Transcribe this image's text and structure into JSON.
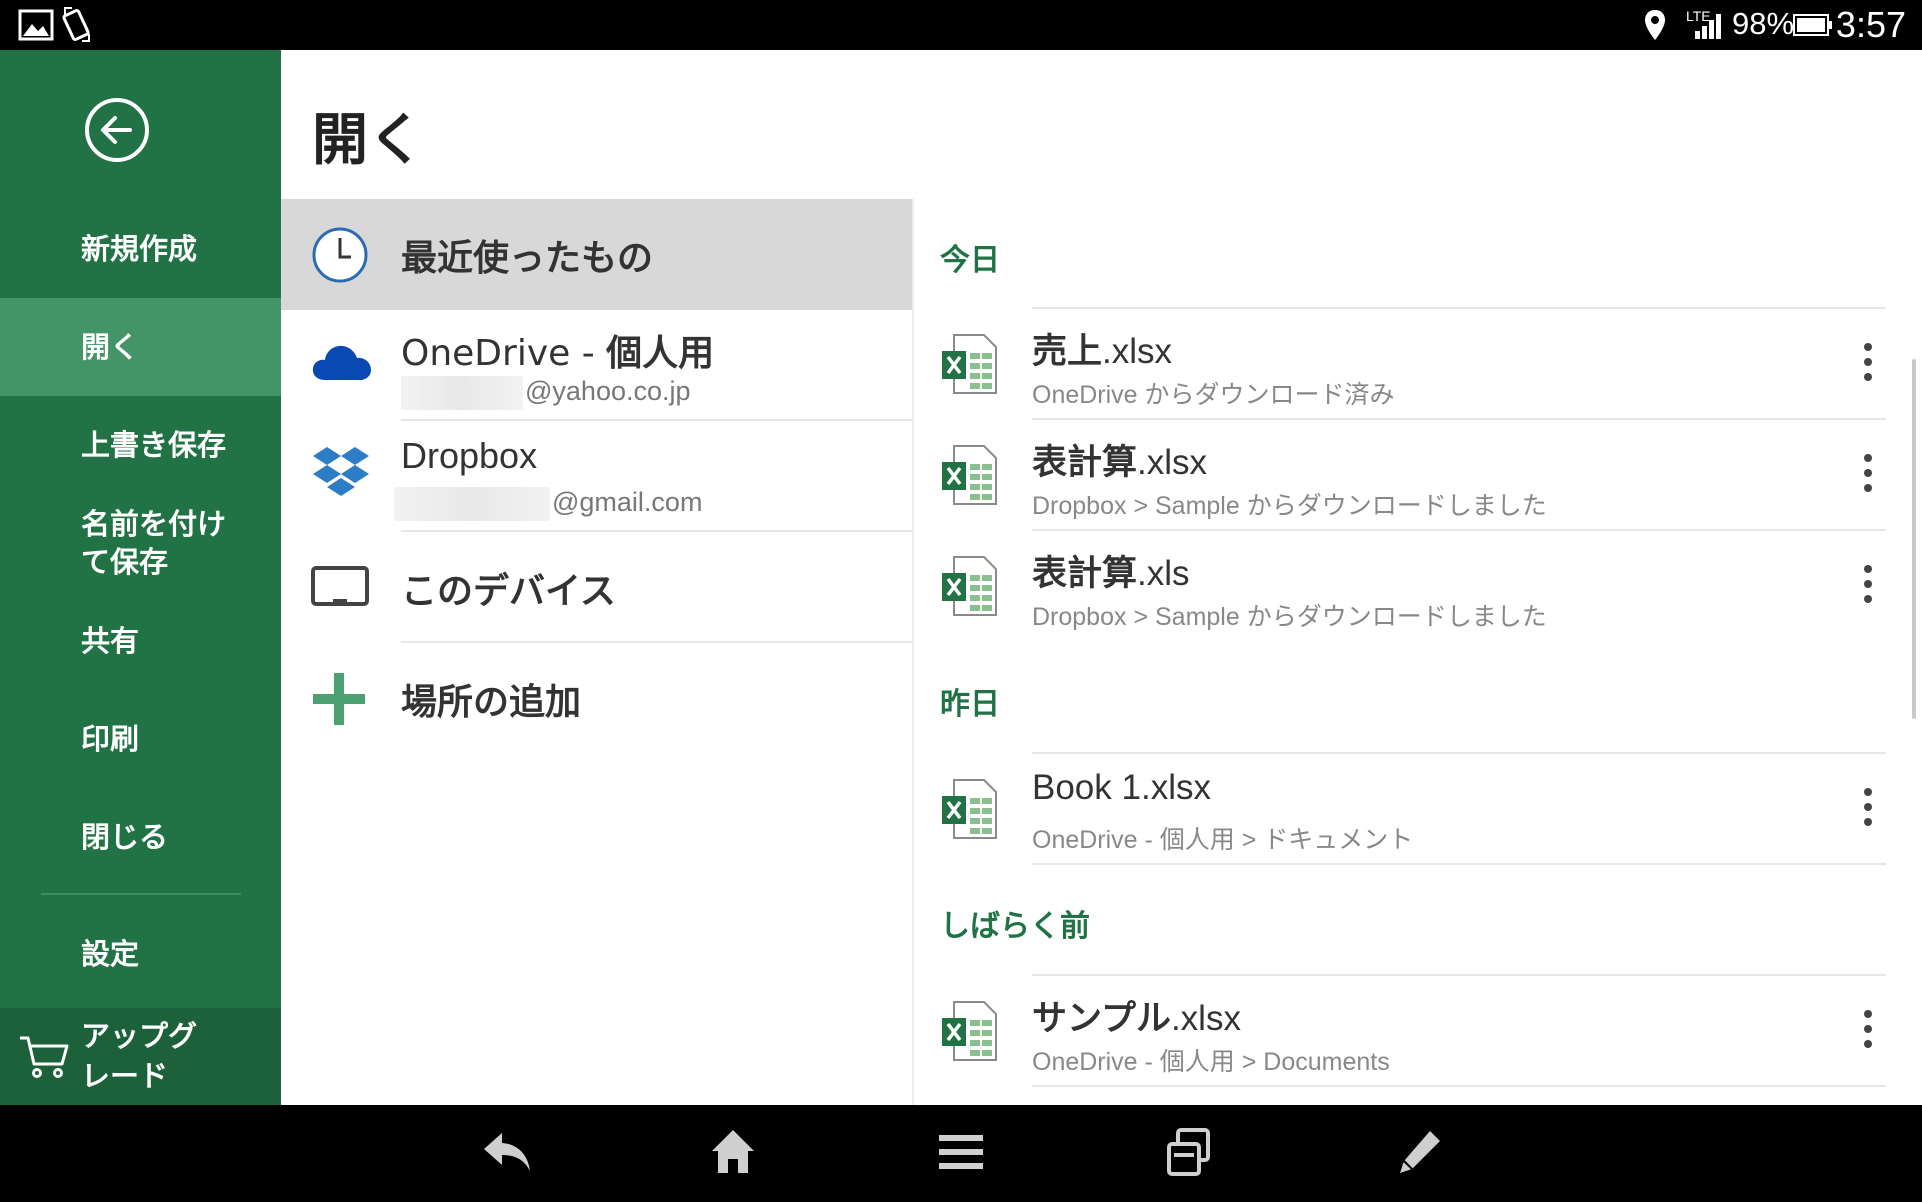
{
  "status_bar": {
    "network": "LTE",
    "battery": "98%",
    "time": "3:57"
  },
  "sidebar": {
    "items": [
      {
        "label": "新規作成"
      },
      {
        "label": "開く"
      },
      {
        "label": "上書き保存"
      },
      {
        "label": "名前を付け\nて保存"
      },
      {
        "label": "共有"
      },
      {
        "label": "印刷"
      },
      {
        "label": "閉じる"
      },
      {
        "label": "設定"
      }
    ],
    "active_index": 1,
    "upgrade_label": "アップグ\nレード"
  },
  "page": {
    "title": "開く"
  },
  "places": [
    {
      "label": "最近使ったもの",
      "sub": ""
    },
    {
      "label_main": "OneDrive - ",
      "label_bold": "個人用",
      "sub": "@yahoo.co.jp"
    },
    {
      "label": "Dropbox",
      "sub": "@gmail.com"
    },
    {
      "label": "このデバイス",
      "sub": ""
    },
    {
      "label": "場所の追加",
      "sub": ""
    }
  ],
  "groups": [
    {
      "heading": "今日",
      "files": [
        {
          "base": "売上",
          "ext": ".xlsx",
          "path": "OneDrive からダウンロード済み"
        },
        {
          "base": "表計算",
          "ext": ".xlsx",
          "path": "Dropbox > Sample からダウンロードしました"
        },
        {
          "base": "表計算",
          "ext": ".xls",
          "path": "Dropbox > Sample からダウンロードしました"
        }
      ]
    },
    {
      "heading": "昨日",
      "files": [
        {
          "base": "Book 1",
          "ext": ".xlsx",
          "path": "OneDrive - 個人用 > ドキュメント"
        }
      ]
    },
    {
      "heading": "しばらく前",
      "files": [
        {
          "base": "サンプル",
          "ext": ".xlsx",
          "path": "OneDrive - 個人用 > Documents"
        }
      ]
    }
  ],
  "colors": {
    "brand_green": "#217346",
    "sidebar_active": "#439467",
    "onedrive_blue": "#094ab2",
    "dropbox_blue": "#2d7cc6"
  },
  "icons": {
    "back": "arrow-left-circle-icon",
    "recent": "clock-icon",
    "onedrive": "cloud-icon",
    "dropbox": "dropbox-icon",
    "device": "tablet-icon",
    "add": "plus-icon",
    "file": "excel-file-icon",
    "more": "more-vertical-icon",
    "cart": "cart-icon"
  }
}
